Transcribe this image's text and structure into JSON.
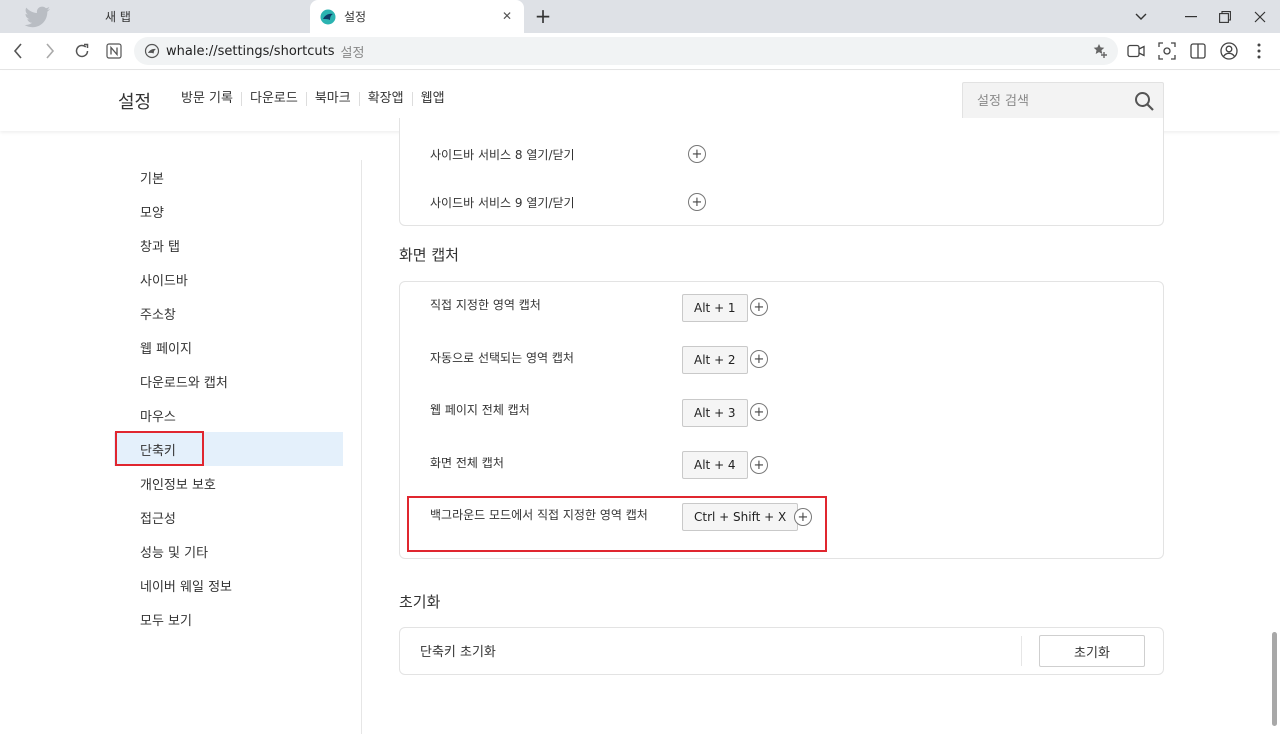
{
  "tabs": [
    {
      "label": "새 탭",
      "active": false
    },
    {
      "label": "설정",
      "active": true
    }
  ],
  "address": {
    "url": "whale://settings/shortcuts",
    "suffix": "설정"
  },
  "header": {
    "title": "설정",
    "links": [
      "방문 기록",
      "다운로드",
      "북마크",
      "확장앱",
      "웹앱"
    ],
    "search_placeholder": "설정 검색"
  },
  "sidebar": {
    "items": [
      {
        "label": "기본"
      },
      {
        "label": "모양"
      },
      {
        "label": "창과 탭"
      },
      {
        "label": "사이드바"
      },
      {
        "label": "주소창"
      },
      {
        "label": "웹 페이지"
      },
      {
        "label": "다운로드와 캡처"
      },
      {
        "label": "마우스"
      },
      {
        "label": "단축키",
        "selected": true
      },
      {
        "label": "개인정보 보호"
      },
      {
        "label": "접근성"
      },
      {
        "label": "성능 및 기타"
      },
      {
        "label": "네이버 웨일 정보"
      },
      {
        "label": "모두 보기"
      }
    ]
  },
  "sidebar_services": {
    "rows": [
      {
        "label": "사이드바 서비스 8 열기/닫기"
      },
      {
        "label": "사이드바 서비스 9 열기/닫기"
      }
    ]
  },
  "capture": {
    "title": "화면 캡처",
    "rows": [
      {
        "label": "직접 지정한 영역 캡처",
        "key": "Alt + 1"
      },
      {
        "label": "자동으로 선택되는 영역 캡처",
        "key": "Alt + 2"
      },
      {
        "label": "웹 페이지 전체 캡처",
        "key": "Alt + 3"
      },
      {
        "label": "화면 전체 캡처",
        "key": "Alt + 4"
      },
      {
        "label": "백그라운드 모드에서 직접 지정한 영역 캡처",
        "key": "Ctrl + Shift + X"
      }
    ]
  },
  "reset": {
    "title": "초기화",
    "row_label": "단축키 초기화",
    "button_label": "초기화"
  },
  "colors": {
    "accent_highlight": "#e0262f",
    "selected_bg": "#e4f0fb",
    "whale_brand": "#2bb3b1"
  }
}
